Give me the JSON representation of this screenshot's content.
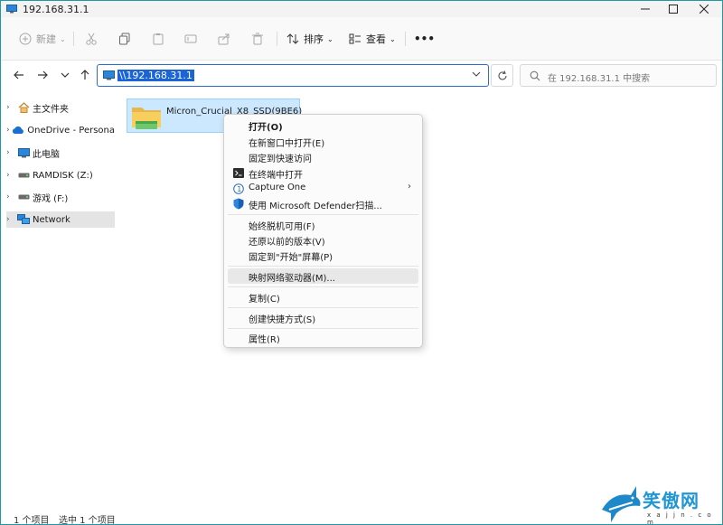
{
  "window": {
    "title": "192.168.31.1",
    "min_icon": "minimize-icon",
    "max_icon": "maximize-icon",
    "close_icon": "close-icon"
  },
  "toolbar": {
    "new_label": "新建",
    "sort_label": "排序",
    "view_label": "查看",
    "more_label": "•••"
  },
  "nav": {
    "address": "\\\\192.168.31.1",
    "search_placeholder": "在 192.168.31.1 中搜索"
  },
  "sidebar": {
    "items": [
      {
        "label": "主文件夹",
        "icon": "home-icon"
      },
      {
        "label": "OneDrive - Persona",
        "icon": "cloud-icon"
      },
      {
        "label": "此电脑",
        "icon": "monitor-icon"
      },
      {
        "label": "RAMDISK (Z:)",
        "icon": "drive-icon"
      },
      {
        "label": "游戏 (F:)",
        "icon": "drive-icon"
      },
      {
        "label": "Network",
        "icon": "network-icon"
      }
    ]
  },
  "content": {
    "folder_name": "Micron_Crucial_X8_SSD(9BE6)"
  },
  "context_menu": {
    "open": "打开(O)",
    "open_new_window": "在新窗口中打开(E)",
    "pin_quick_access": "固定到快速访问",
    "open_in_terminal": "在终端中打开",
    "capture_one": "Capture One",
    "defender_scan": "使用 Microsoft Defender扫描...",
    "always_offline": "始终脱机可用(F)",
    "restore_versions": "还原以前的版本(V)",
    "pin_start": "固定到\"开始\"屏幕(P)",
    "map_drive": "映射网络驱动器(M)...",
    "copy": "复制(C)",
    "create_shortcut": "创建快捷方式(S)",
    "properties": "属性(R)"
  },
  "status": {
    "count": "1 个项目",
    "selected": "选中 1 个项目"
  },
  "watermark": {
    "name": "笑傲网",
    "url": "x a j j n . c o m"
  },
  "colors": {
    "accent": "#1a64d6",
    "selection": "#cce8ff",
    "window_border": "#1d9aa4"
  }
}
